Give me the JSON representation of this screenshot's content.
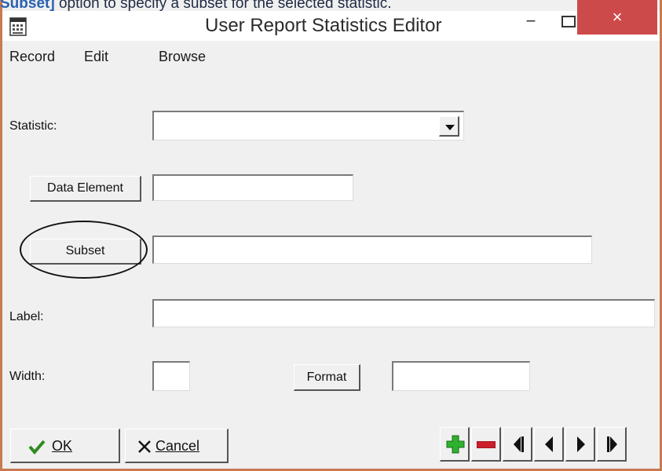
{
  "caption": {
    "prefix": "Subset]",
    "rest": " option to specify a subset for the selected statistic."
  },
  "window": {
    "title": "User Report Statistics Editor",
    "minimize": "−",
    "close": "×"
  },
  "menu": [
    "Record",
    "Edit",
    "Browse"
  ],
  "form": {
    "statistic_label": "Statistic:",
    "statistic_value": "",
    "data_element_button": "Data Element",
    "data_element_value": "",
    "subset_button": "Subset",
    "subset_value": "",
    "label_label": "Label:",
    "label_value": "",
    "width_label": "Width:",
    "width_value": "",
    "format_button": "Format",
    "format_value": ""
  },
  "buttons": {
    "ok_label": "OK",
    "cancel_label": "Cancel"
  },
  "icons": {
    "ok": "checkmark-icon",
    "cancel": "x-icon",
    "add": "plus-icon",
    "delete": "minus-icon",
    "first": "first-record-icon",
    "prev": "previous-record-icon",
    "next": "next-record-icon",
    "last": "last-record-icon"
  },
  "colors": {
    "close_button": "#cd4a4a",
    "add_icon": "#2fb12f",
    "delete_icon": "#cc1e2c",
    "ok_check": "#2e8b1e",
    "window_border": "#c87a50",
    "caption_highlight": "#2a62b0"
  }
}
